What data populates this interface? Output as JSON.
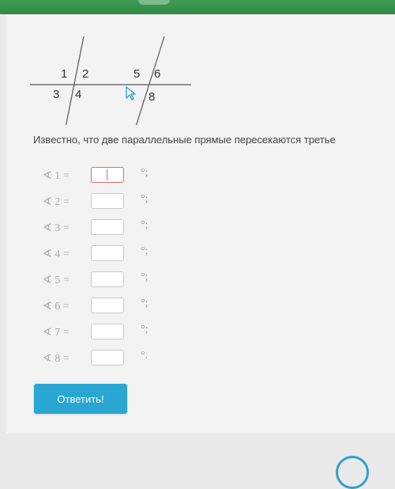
{
  "figure": {
    "labels": [
      "1",
      "2",
      "3",
      "4",
      "5",
      "6",
      "8"
    ]
  },
  "question": {
    "text": "Известно, что две параллельные прямые пересекаются третье"
  },
  "angles": [
    {
      "label": "∢ 1 =",
      "suffix": "°;"
    },
    {
      "label": "∢ 2 =",
      "suffix": "°;"
    },
    {
      "label": "∢ 3 =",
      "suffix": "°;"
    },
    {
      "label": "∢ 4 =",
      "suffix": "°;"
    },
    {
      "label": "∢ 5 =",
      "suffix": "°;"
    },
    {
      "label": "∢ 6 =",
      "suffix": "°;"
    },
    {
      "label": "∢ 7 =",
      "suffix": "°;"
    },
    {
      "label": "∢ 8 =",
      "suffix": "°."
    }
  ],
  "submit": {
    "label": "Ответить!"
  },
  "colors": {
    "top_bar": "#2f8a45",
    "button": "#29a6d2",
    "active_border": "#e06a6a"
  },
  "icons": {
    "cursor": "mouse-pointer-icon"
  }
}
